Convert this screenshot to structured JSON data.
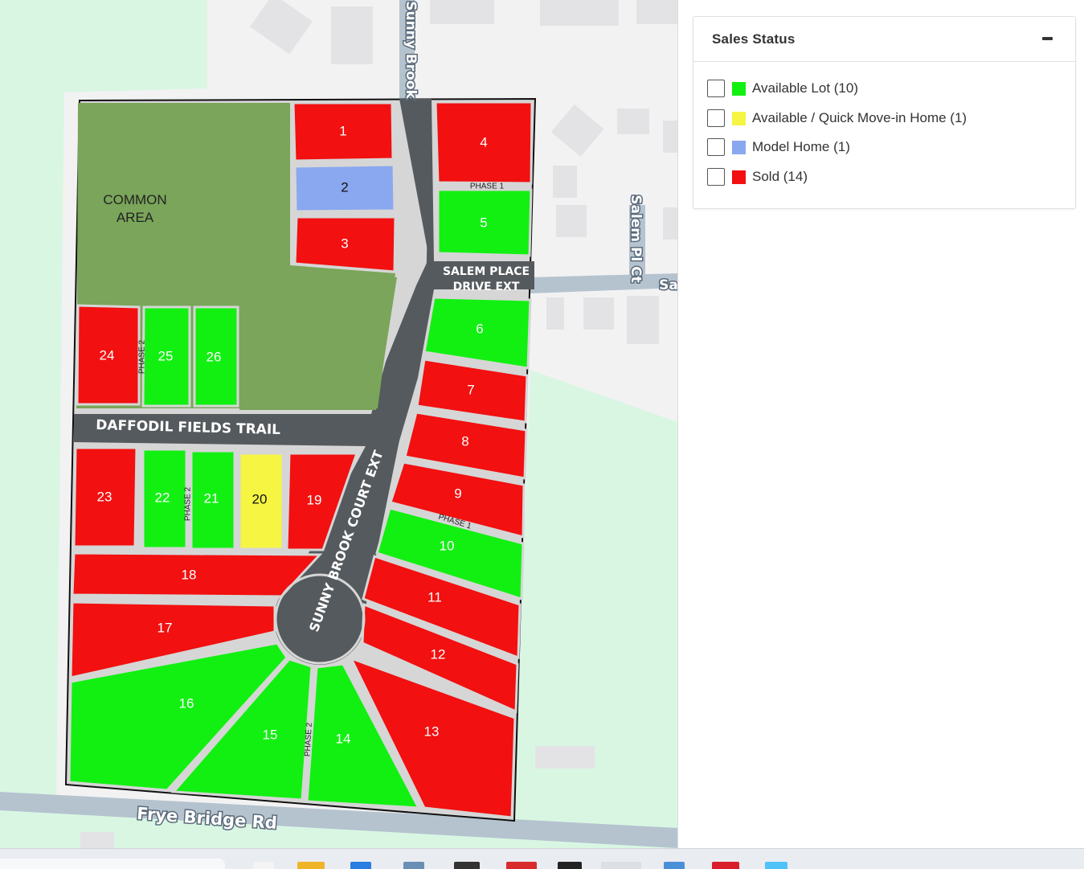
{
  "map": {
    "common_area_label": [
      "COMMON",
      "AREA"
    ],
    "streets": {
      "sunny_brook": "Sunny Brook",
      "salem_pl_ct": "Salem Pl Ct",
      "salem_cut": "Sa",
      "frye_bridge": "Frye Bridge Rd",
      "salem_place_ext": [
        "SALEM PLACE",
        "DRIVE EXT"
      ],
      "daffodil": "DAFFODIL FIELDS TRAIL",
      "sunny_court": "SUNNY BROOK COURT EXT"
    },
    "phase_labels": {
      "p1_top": "PHASE 1",
      "p1_right": "PHASE 1",
      "p2_top": "PHASE 2",
      "p2_mid": "PHASE 2",
      "p2_bottom": "PHASE 2"
    },
    "status_colors": {
      "available": "#12f012",
      "quick": "#f5f542",
      "model": "#8aa8f0",
      "sold": "#f21010"
    },
    "lots": [
      {
        "id": "1",
        "status": "sold"
      },
      {
        "id": "2",
        "status": "model"
      },
      {
        "id": "3",
        "status": "sold"
      },
      {
        "id": "4",
        "status": "sold"
      },
      {
        "id": "5",
        "status": "available"
      },
      {
        "id": "6",
        "status": "available"
      },
      {
        "id": "7",
        "status": "sold"
      },
      {
        "id": "8",
        "status": "sold"
      },
      {
        "id": "9",
        "status": "sold"
      },
      {
        "id": "10",
        "status": "available"
      },
      {
        "id": "11",
        "status": "sold"
      },
      {
        "id": "12",
        "status": "sold"
      },
      {
        "id": "13",
        "status": "sold"
      },
      {
        "id": "14",
        "status": "available"
      },
      {
        "id": "15",
        "status": "available"
      },
      {
        "id": "16",
        "status": "available"
      },
      {
        "id": "17",
        "status": "sold"
      },
      {
        "id": "18",
        "status": "sold"
      },
      {
        "id": "19",
        "status": "sold"
      },
      {
        "id": "20",
        "status": "quick"
      },
      {
        "id": "21",
        "status": "available"
      },
      {
        "id": "22",
        "status": "available"
      },
      {
        "id": "23",
        "status": "sold"
      },
      {
        "id": "24",
        "status": "sold"
      },
      {
        "id": "25",
        "status": "available"
      },
      {
        "id": "26",
        "status": "available"
      }
    ]
  },
  "legend": {
    "title": "Sales Status",
    "items": [
      {
        "label": "Available Lot (10)",
        "color": "#12f012"
      },
      {
        "label": "Available / Quick Move-in Home (1)",
        "color": "#f5f542"
      },
      {
        "label": "Model Home (1)",
        "color": "#8aa8f0"
      },
      {
        "label": "Sold (14)",
        "color": "#f21010"
      }
    ]
  }
}
